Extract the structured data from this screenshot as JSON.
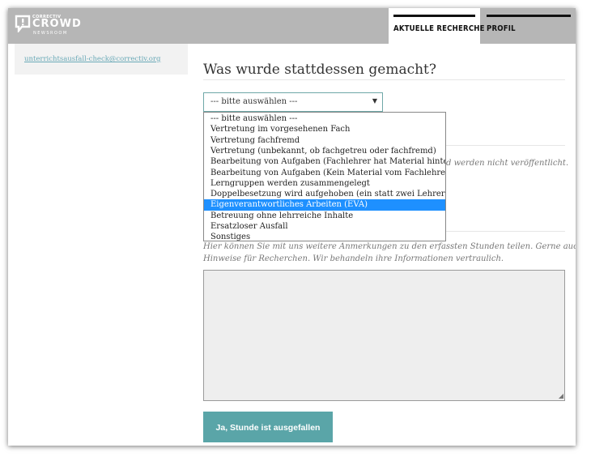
{
  "brand": {
    "small": "CORRECTIV",
    "name": "CROWD",
    "sub": "NEWSROOM"
  },
  "nav": {
    "active_tab": "AKTUELLE RECHERCHE",
    "profile_tab": "PROFIL"
  },
  "sidebar": {
    "email_link": "unterrichtsausfall-check@correctiv.org"
  },
  "main": {
    "heading": "Was wurde stattdessen gemacht?",
    "select_value": "--- bitte auswählen ---",
    "select_arrow": "▼",
    "hidden_text_right": "d werden nicht veröffentlicht.",
    "notes_line1": "Hier können Sie mit uns weitere Anmerkungen zu den erfassten Stunden teilen. Gerne auch",
    "notes_line2": "Hinweise für Recherchen. Wir behandeln ihre Informationen vertraulich.",
    "submit_label": "Ja, Stunde ist ausgefallen"
  },
  "dropdown_options": [
    "--- bitte auswählen ---",
    "Vertretung im vorgesehenen Fach",
    "Vertretung fachfremd",
    "Vertretung (unbekannt, ob fachgetreu oder fachfremd)",
    "Bearbeitung von Aufgaben (Fachlehrer hat Material hinterlegt)",
    "Bearbeitung von Aufgaben (Kein Material vom Fachlehrer)",
    "Lerngruppen werden zusammengelegt",
    "Doppelbesetzung wird aufgehoben (ein statt zwei Lehrer)",
    "Eigenverantwortliches Arbeiten (EVA)",
    "Betreuung ohne lehrreiche Inhalte",
    "Ersatzloser Ausfall",
    "Sonstiges"
  ],
  "highlighted_option_index": 8,
  "colors": {
    "accent": "#5aa5a8",
    "link": "#6aa9b7",
    "highlight": "#1e90ff",
    "topbar": "#b6b6b6"
  }
}
